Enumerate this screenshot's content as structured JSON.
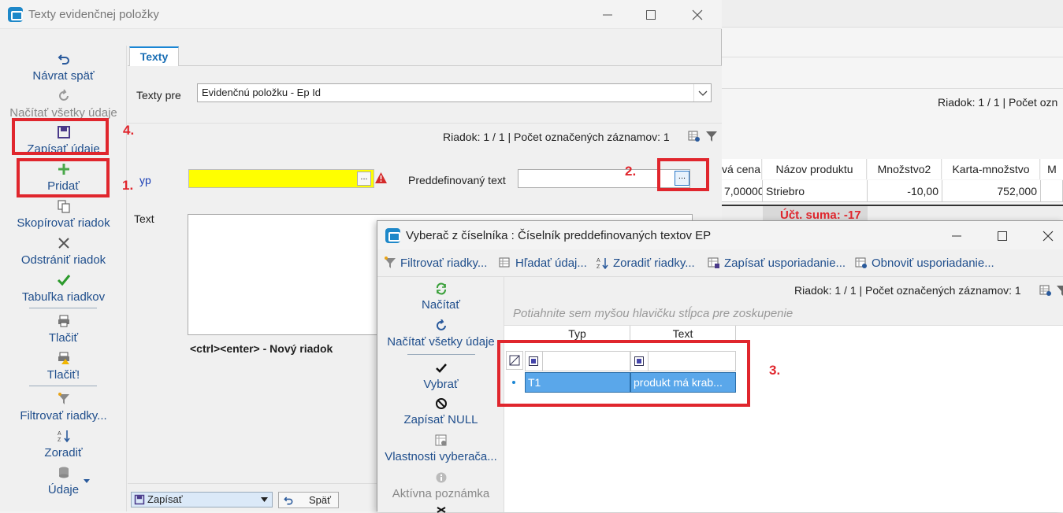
{
  "background_window": {
    "row_info": "Riadok: 1 / 1 | Počet ozn",
    "columns": [
      "vá cena",
      "Názov produktu",
      "Množstvo2",
      "Karta-množstvo",
      "M"
    ],
    "row": [
      "7,00000",
      "Striebro",
      "-10,00",
      "752,000",
      ""
    ],
    "footer_text": "Účt. suma: -17"
  },
  "main_window": {
    "title": "Texty evidenčnej položky",
    "sidebar": [
      {
        "label": "Návrat späť",
        "icon": "undo-icon"
      },
      {
        "label": "Načítať všetky údaje",
        "icon": "refresh-icon"
      },
      {
        "label": "Zapísať údaje",
        "icon": "save-icon"
      },
      {
        "label": "Pridať",
        "icon": "plus-icon"
      },
      {
        "label": "Skopírovať riadok",
        "icon": "copy-icon"
      },
      {
        "label": "Odstrániť riadok",
        "icon": "delete-icon"
      },
      {
        "label": "Tabuľka riadkov",
        "icon": "check-icon"
      },
      {
        "label": "Tlačiť",
        "icon": "print-icon"
      },
      {
        "label": "Tlačiť!",
        "icon": "print-warning-icon"
      },
      {
        "label": "Filtrovať riadky...",
        "icon": "filter-icon"
      },
      {
        "label": "Zoradiť",
        "icon": "sort-icon"
      },
      {
        "label": "Údaje",
        "icon": "data-icon"
      }
    ],
    "tab": "Texty",
    "texty_pre_label": "Texty pre",
    "texty_pre_value": "Evidenčnú položku - Ep Id",
    "row_info": "Riadok: 1 / 1 | Počet označených záznamov: 1",
    "typ_label": "yp",
    "predef_label": "Preddefinovaný text",
    "text_label": "Text",
    "hint": "<ctrl><enter> - Nový riadok",
    "dots": "...",
    "bottom": {
      "save_label": "Zapísať",
      "back_label": "Späť"
    }
  },
  "annotations": [
    "1.",
    "2.",
    "3.",
    "4."
  ],
  "picker": {
    "title": "Vyberač z číselníka : Číselník preddefinovaných textov EP",
    "toolbar": [
      {
        "label": "Filtrovať riadky...",
        "icon": "filter-icon"
      },
      {
        "label": "Hľadať údaj...",
        "icon": "find-icon"
      },
      {
        "label": "Zoradiť riadky...",
        "icon": "sort-icon"
      },
      {
        "label": "Zapísať usporiadanie...",
        "icon": "save-layout-icon"
      },
      {
        "label": "Obnoviť usporiadanie...",
        "icon": "restore-layout-icon"
      }
    ],
    "sidebar": [
      {
        "label": "Načítať",
        "icon": "reload-icon"
      },
      {
        "label": "Načítať všetky údaje",
        "icon": "refresh-icon"
      },
      {
        "label": "Vybrať",
        "icon": "check-icon"
      },
      {
        "label": "Zapísať NULL",
        "icon": "null-icon"
      },
      {
        "label": "Vlastnosti vyberača...",
        "icon": "properties-icon"
      },
      {
        "label": "Aktívna poznámka",
        "icon": "note-icon"
      }
    ],
    "row_info": "Riadok: 1 / 1 | Počet označených záznamov: 1",
    "group_hint": "Potiahnite sem myšou hlavičku stĺpca pre zoskupenie",
    "columns": [
      "Typ",
      "Text"
    ],
    "rows": [
      {
        "typ": "T1",
        "text": "produkt má krab..."
      }
    ]
  }
}
